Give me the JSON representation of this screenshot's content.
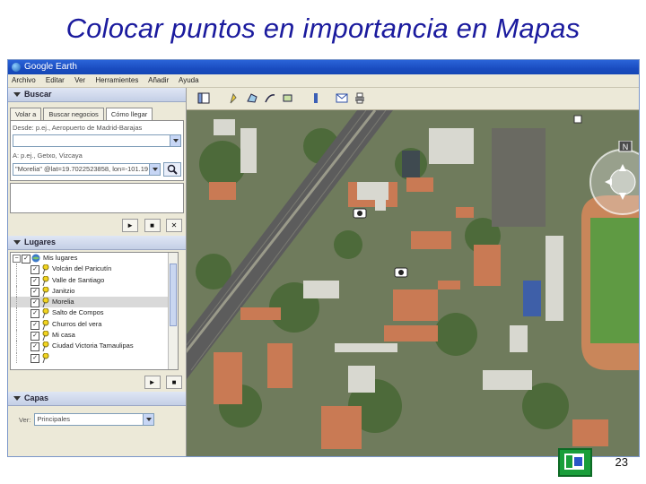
{
  "slide": {
    "title": "Colocar puntos en importancia en Mapas",
    "page_number": "23"
  },
  "window": {
    "title": "Google Earth",
    "menu": [
      "Archivo",
      "Editar",
      "Ver",
      "Herramientes",
      "Añadir",
      "Ayuda"
    ]
  },
  "search_panel": {
    "header": "Buscar",
    "tabs": [
      "Volar a",
      "Buscar negocios",
      "Cómo llegar"
    ],
    "active_tab": 2,
    "from_label": "Desde: p.ej., Aeropuerto de Madrid-Barajas",
    "from_value": "",
    "to_label": "A: p.ej., Getxo, Vizcaya",
    "to_value": "\"Morelia\" @lat=19.7022523858, lon=-101.19"
  },
  "places_panel": {
    "header": "Lugares",
    "root": "Mis lugares",
    "items": [
      {
        "label": "Volcán del Paricutín",
        "checked": true,
        "selected": false
      },
      {
        "label": "Valle de Santiago",
        "checked": true,
        "selected": false
      },
      {
        "label": "Janitzio",
        "checked": true,
        "selected": false
      },
      {
        "label": "Morelia",
        "checked": true,
        "selected": true
      },
      {
        "label": "Salto de Compos",
        "checked": true,
        "selected": false
      },
      {
        "label": "Churros del vera",
        "checked": true,
        "selected": false
      },
      {
        "label": "Mi casa",
        "checked": true,
        "selected": false
      },
      {
        "label": "Ciudad Victoria Tamaulipas",
        "checked": true,
        "selected": false
      },
      {
        "label": "",
        "checked": true,
        "selected": false
      }
    ]
  },
  "layers_panel": {
    "header": "Capas",
    "view_label": "Ver:",
    "view_value": "Principales"
  },
  "controls": {
    "play": "►",
    "stop": "■",
    "close": "✕"
  },
  "toolbar_icons": [
    "sidebar-icon",
    "placemark-icon",
    "polygon-icon",
    "path-icon",
    "overlay-icon",
    "ruler-icon",
    "email-icon",
    "print-icon"
  ],
  "navigation": {
    "north_label": "N"
  },
  "colors": {
    "title": "#1b1b9e",
    "titlebar": "#2b64d8",
    "panel_bg": "#ece9d8"
  }
}
